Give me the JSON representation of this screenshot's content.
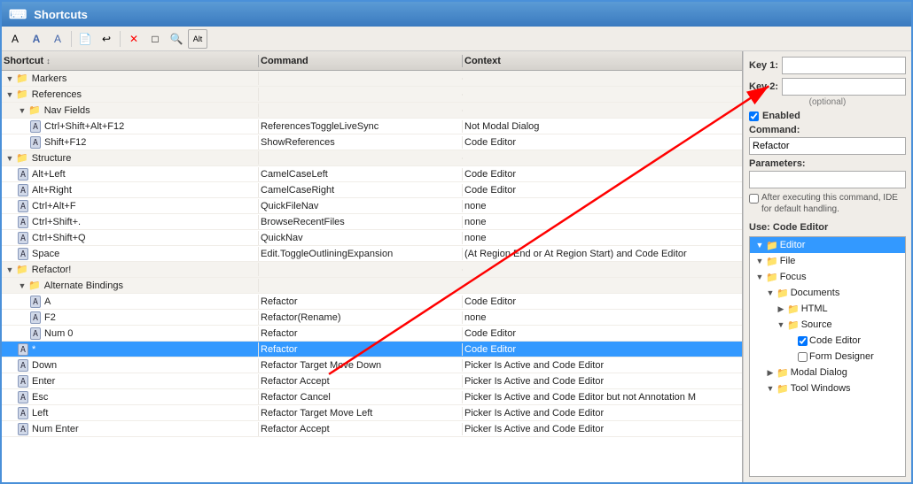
{
  "window": {
    "title": "Shortcuts"
  },
  "toolbar": {
    "buttons": [
      {
        "icon": "A",
        "label": "add",
        "title": "Add"
      },
      {
        "icon": "✏",
        "label": "edit",
        "title": "Edit"
      },
      {
        "icon": "A",
        "label": "copy",
        "title": "Copy"
      },
      {
        "icon": "📄",
        "label": "new",
        "title": "New"
      },
      {
        "icon": "↩",
        "label": "undo",
        "title": "Undo"
      },
      {
        "icon": "✕",
        "label": "delete",
        "title": "Delete"
      },
      {
        "icon": "□",
        "label": "clear",
        "title": "Clear"
      },
      {
        "icon": "🔍",
        "label": "search",
        "title": "Search"
      },
      {
        "icon": "Alt",
        "label": "alt",
        "title": "Alt"
      }
    ]
  },
  "table": {
    "columns": {
      "shortcut": "Shortcut",
      "command": "Command",
      "context": "Context"
    },
    "rows": [
      {
        "indent": 1,
        "type": "group",
        "icon": "folder",
        "shortcut": "Markers",
        "command": "",
        "context": ""
      },
      {
        "indent": 1,
        "type": "group",
        "icon": "folder",
        "shortcut": "References",
        "command": "",
        "context": ""
      },
      {
        "indent": 2,
        "type": "group",
        "icon": "folder",
        "shortcut": "Nav Fields",
        "command": "",
        "context": ""
      },
      {
        "indent": 3,
        "type": "item",
        "icon": "key",
        "shortcut": "Ctrl+Shift+Alt+F12",
        "command": "ReferencesToggleLiveSync",
        "context": "Not Modal Dialog"
      },
      {
        "indent": 3,
        "type": "item",
        "icon": "key",
        "shortcut": "Shift+F12",
        "command": "ShowReferences",
        "context": "Code Editor"
      },
      {
        "indent": 1,
        "type": "group",
        "icon": "folder",
        "shortcut": "Structure",
        "command": "",
        "context": ""
      },
      {
        "indent": 2,
        "type": "item",
        "icon": "key",
        "shortcut": "Alt+Left",
        "command": "CamelCaseLeft",
        "context": "Code Editor"
      },
      {
        "indent": 2,
        "type": "item",
        "icon": "key",
        "shortcut": "Alt+Right",
        "command": "CamelCaseRight",
        "context": "Code Editor"
      },
      {
        "indent": 2,
        "type": "item",
        "icon": "key",
        "shortcut": "Ctrl+Alt+F",
        "command": "QuickFileNav",
        "context": "none"
      },
      {
        "indent": 2,
        "type": "item",
        "icon": "key",
        "shortcut": "Ctrl+Shift+.",
        "command": "BrowseRecentFiles",
        "context": "none"
      },
      {
        "indent": 2,
        "type": "item",
        "icon": "key",
        "shortcut": "Ctrl+Shift+Q",
        "command": "QuickNav",
        "context": "none"
      },
      {
        "indent": 2,
        "type": "item",
        "icon": "key",
        "shortcut": "Space",
        "command": "Edit.ToggleOutliningExpansion",
        "context": "(At Region End or At Region Start) and Code Editor"
      },
      {
        "indent": 1,
        "type": "group",
        "icon": "folder",
        "shortcut": "Refactor!",
        "command": "",
        "context": ""
      },
      {
        "indent": 2,
        "type": "group",
        "icon": "folder",
        "shortcut": "Alternate Bindings",
        "command": "",
        "context": ""
      },
      {
        "indent": 3,
        "type": "item",
        "icon": "key",
        "shortcut": "A",
        "command": "Refactor",
        "context": "Code Editor"
      },
      {
        "indent": 3,
        "type": "item",
        "icon": "key",
        "shortcut": "F2",
        "command": "Refactor(Rename)",
        "context": "none"
      },
      {
        "indent": 3,
        "type": "item",
        "icon": "key",
        "shortcut": "Num 0",
        "command": "Refactor",
        "context": "Code Editor"
      },
      {
        "indent": 2,
        "type": "item",
        "icon": "key",
        "shortcut": "*",
        "command": "Refactor",
        "context": "Code Editor",
        "selected": true
      },
      {
        "indent": 2,
        "type": "item",
        "icon": "key",
        "shortcut": "Down",
        "command": "Refactor Target Move Down",
        "context": "Picker Is Active and Code Editor"
      },
      {
        "indent": 2,
        "type": "item",
        "icon": "key",
        "shortcut": "Enter",
        "command": "Refactor Accept",
        "context": "Picker Is Active and Code Editor"
      },
      {
        "indent": 2,
        "type": "item",
        "icon": "key",
        "shortcut": "Esc",
        "command": "Refactor Cancel",
        "context": "Picker Is Active and Code Editor but not Annotation M"
      },
      {
        "indent": 2,
        "type": "item",
        "icon": "key",
        "shortcut": "Left",
        "command": "Refactor Target Move Left",
        "context": "Picker Is Active and Code Editor"
      },
      {
        "indent": 2,
        "type": "item",
        "icon": "key",
        "shortcut": "Num Enter",
        "command": "Refactor Accept",
        "context": "Picker Is Active and Code Editor"
      }
    ]
  },
  "right_panel": {
    "key1_label": "Key 1:",
    "key1_value": "",
    "key2_label": "Key 2:",
    "key2_value": "",
    "key2_hint": "(optional)",
    "enabled_label": "Enabled",
    "enabled_checked": true,
    "command_label": "Command:",
    "command_value": "Refactor",
    "parameters_label": "Parameters:",
    "parameters_value": "",
    "note_text": "After executing this command, IDE for default handling.",
    "note_checked": false,
    "use_label": "Use:  Code Editor",
    "use_tree": [
      {
        "indent": 0,
        "icon": "folder",
        "expand": true,
        "label": "Editor",
        "selected": true,
        "checkbox": null
      },
      {
        "indent": 0,
        "icon": "folder",
        "expand": true,
        "label": "File",
        "selected": false,
        "checkbox": null
      },
      {
        "indent": 0,
        "icon": "folder",
        "expand": true,
        "label": "Focus",
        "selected": false,
        "checkbox": null
      },
      {
        "indent": 1,
        "icon": "folder",
        "expand": true,
        "label": "Documents",
        "selected": false,
        "checkbox": null
      },
      {
        "indent": 2,
        "icon": "folder",
        "expand": false,
        "label": "HTML",
        "selected": false,
        "checkbox": null
      },
      {
        "indent": 2,
        "icon": "folder",
        "expand": true,
        "label": "Source",
        "selected": false,
        "checkbox": null
      },
      {
        "indent": 3,
        "icon": null,
        "expand": false,
        "label": "Code Editor",
        "selected": false,
        "checkbox": true
      },
      {
        "indent": 3,
        "icon": null,
        "expand": false,
        "label": "Form Designer",
        "selected": false,
        "checkbox": false
      },
      {
        "indent": 1,
        "icon": "folder",
        "expand": false,
        "label": "Modal Dialog",
        "selected": false,
        "checkbox": null
      },
      {
        "indent": 1,
        "icon": "folder",
        "expand": true,
        "label": "Tool Windows",
        "selected": false,
        "checkbox": null
      }
    ]
  },
  "colors": {
    "selected_bg": "#3399ff",
    "selected_text": "#ffffff",
    "header_bg": "#e0ddd8",
    "folder_color": "#e8a020",
    "title_bar_start": "#5b9bd5",
    "title_bar_end": "#3a7abf",
    "accent_blue": "#3399ff"
  }
}
